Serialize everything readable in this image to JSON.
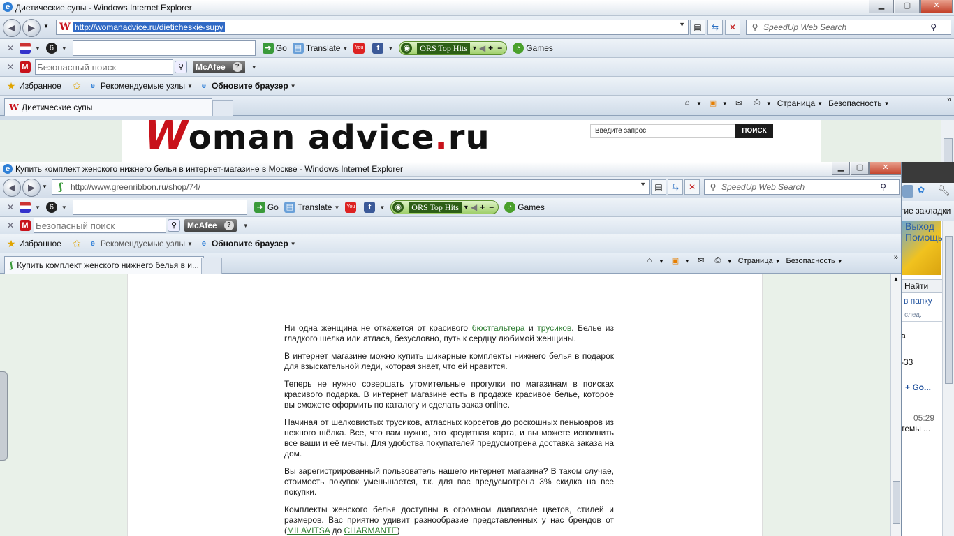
{
  "window1": {
    "title": "Диетические супы - Windows Internet Explorer",
    "address": "http://womanadvice.ru/dieticheskie-supy",
    "search_placeholder": "SpeedUp Web Search",
    "tab_title": "Диетические супы",
    "site": {
      "logo_w": "W",
      "logo_mid": "oman advice",
      "logo_dot": ".",
      "logo_end": "ru",
      "search_placeholder": "Введите запрос",
      "search_button": "ПОИСК"
    }
  },
  "window2": {
    "title": "Купить комплект женского нижнего белья в интернет-магазине в Москве - Windows Internet Explorer",
    "address": "http://www.greenribbon.ru/shop/74/",
    "search_placeholder": "SpeedUp Web Search",
    "tab_title": "Купить комплект женского нижнего белья в и...",
    "article": {
      "p1_a": "Ни одна женщина не откажется от красивого ",
      "p1_link1": "бюстгальтера",
      "p1_b": " и ",
      "p1_link2": "трусиков",
      "p1_c": ". Белье из гладкого шелка или атласа, безусловно, путь к сердцу любимой женщины.",
      "p2": "В интернет магазине можно купить шикарные комплекты нижнего белья в подарок для взыскательной леди, которая знает, что ей нравится.",
      "p3": "Теперь не нужно совершать утомительные прогулки по магазинам в поисках красивого подарка. В интернет магазине есть в продаже красивое белье, которое вы сможете оформить по каталогу и сделать заказ online.",
      "p4": "Начиная от шелковистых трусиков, атласных корсетов до роскошных пеньюаров из нежного шёлка. Все, что вам нужно, это кредитная карта, и вы можете исполнить все ваши и её мечты. Для удобства покупателей предусмотрена доставка заказа на дом.",
      "p5": "Вы зарегистрированный пользователь нашего интернет магазина? В таком случае, стоимость покупок уменьшается, т.к. для вас предусмотрена 3% скидка на все покупки.",
      "p6_a": "Комплекты женского белья доступны в огромном диапазоне цветов, стилей и размеров. Вас приятно удивит разнообразие представленных у нас брендов от (",
      "p6_link1": "MILAVITSA",
      "p6_b": " до ",
      "p6_link2": "CHARMANTE",
      "p6_c": ")"
    }
  },
  "toolbar": {
    "go": "Go",
    "translate": "Translate",
    "ors": "ORS Top Hits",
    "ors_plus": "+",
    "ors_minus": "−",
    "games": "Games"
  },
  "mcafee": {
    "search_placeholder": "Безопасный поиск",
    "brand": "McAfee",
    "help": "?"
  },
  "favbar": {
    "favorites": "Избранное",
    "suggested": "Рекомендуемые узлы",
    "update": "Обновите браузер"
  },
  "cmd": {
    "page": "Страница",
    "safety": "Безопасность"
  },
  "peek": {
    "bookmarks": "гие закладки",
    "exit": "Выход",
    "help": "Помощь",
    "find": "Найти",
    "folder": "в папку",
    "next": "след.",
    "letter": "а",
    "phone": "-33",
    "go": "+ Go...",
    "time": "05:29",
    "systems": "темы ..."
  },
  "colors": {
    "accent_red": "#c8121b",
    "link_green": "#2e7d32",
    "selection": "#316ac5"
  }
}
